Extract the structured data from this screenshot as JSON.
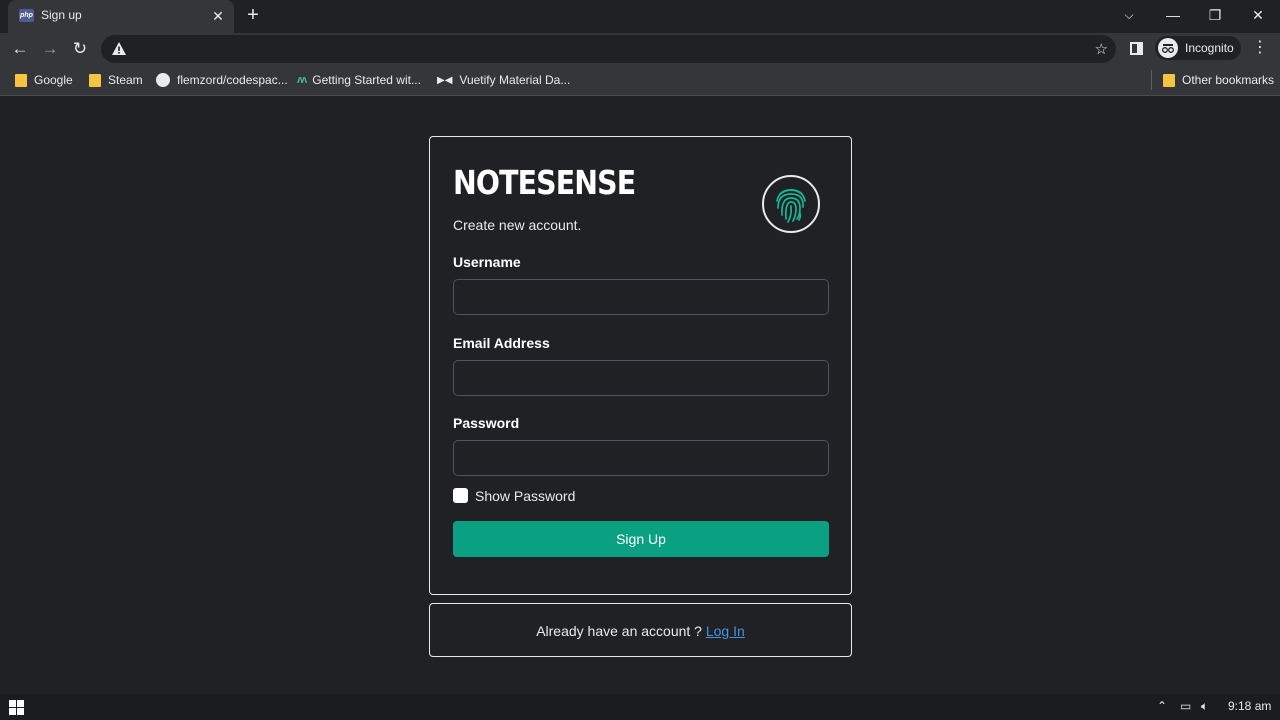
{
  "browser": {
    "tab": {
      "favicon_text": "php",
      "title": "Sign up",
      "close": "✕"
    },
    "new_tab": "+",
    "window_controls": {
      "tab_search": "⌵",
      "minimize": "—",
      "restore": "❐",
      "close": "✕"
    },
    "nav": {
      "back": "←",
      "forward": "→",
      "reload": "↻"
    },
    "omnibox": {
      "security_icon": "warning-icon",
      "star": "☆"
    },
    "profile": {
      "label": "Incognito"
    },
    "menu": "⋮",
    "bookmarks": [
      {
        "label": "Google",
        "icon": "folder-icon"
      },
      {
        "label": "Steam",
        "icon": "folder-icon"
      },
      {
        "label": "flemzord/codespac...",
        "icon": "github-icon"
      },
      {
        "label": "Getting Started wit...",
        "icon": "mathjax-icon"
      },
      {
        "label": "Vuetify Material Da...",
        "icon": "vuetify-icon"
      }
    ],
    "other_bookmarks": "Other bookmarks"
  },
  "form": {
    "brand": "NOTESENSE",
    "subtitle": "Create new account.",
    "username_label": "Username",
    "username_value": "",
    "email_label": "Email Address",
    "email_value": "",
    "password_label": "Password",
    "password_value": "",
    "show_password_label": "Show Password",
    "show_password_checked": false,
    "submit_label": "Sign Up",
    "accent_color": "#0aa182"
  },
  "footer_card": {
    "prompt": "Already have an account ? ",
    "link_label": "Log In"
  },
  "taskbar": {
    "clock": "9:18 am"
  }
}
